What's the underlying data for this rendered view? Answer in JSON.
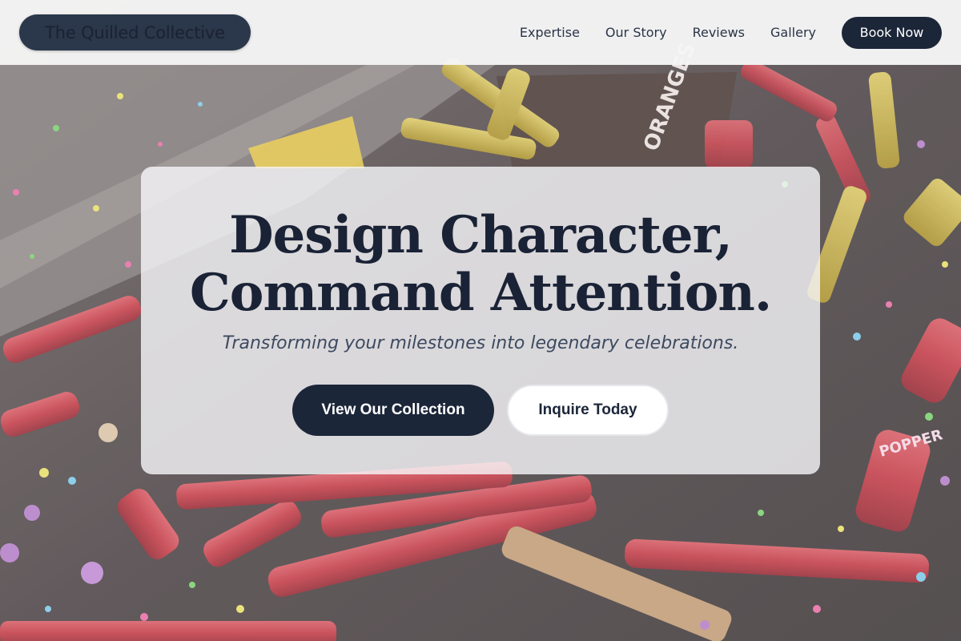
{
  "header": {
    "brand": "The Quilled Collective",
    "nav": [
      "Expertise",
      "Our Story",
      "Reviews",
      "Gallery"
    ],
    "cta_label": "Book Now"
  },
  "hero": {
    "title_line_1": "Design Character,",
    "title_line_2": "Command Attention.",
    "subtitle": "Transforming your milestones into legendary celebrations.",
    "primary_label": "View Our Collection",
    "secondary_label": "Inquire Today"
  },
  "background": {
    "image": "confetti-and-spent-party-poppers-photo",
    "box_print": "ORANGES",
    "popper_print": "POPPER"
  },
  "colors": {
    "navy": "#1c2639",
    "header_bg": "#f5f5f5",
    "card_bg": "#f8f8fa"
  }
}
